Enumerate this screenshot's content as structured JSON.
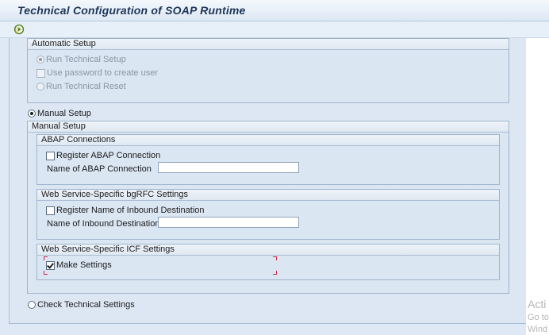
{
  "window": {
    "title": "Technical Configuration of SOAP Runtime"
  },
  "toolbar": {
    "execute_icon": "execute-icon"
  },
  "automatic_setup": {
    "header": "Automatic Setup",
    "run_technical_setup": "Run Technical Setup",
    "use_password": "Use password to create user",
    "run_technical_reset": "Run Technical Reset"
  },
  "manual_setup": {
    "radio_label": "Manual Setup",
    "header": "Manual Setup",
    "abap": {
      "header": "ABAP Connections",
      "register_label": "Register ABAP Connection",
      "name_label": "Name of ABAP Connection",
      "name_value": ""
    },
    "bgrfc": {
      "header": "Web Service-Specific bgRFC Settings",
      "register_label": "Register Name of Inbound Destination",
      "name_label": "Name of Inbound Destination",
      "name_value": ""
    },
    "icf": {
      "header": "Web Service-Specific ICF Settings",
      "make_settings_label": "Make Settings"
    }
  },
  "check_settings": {
    "radio_label": "Check Technical Settings"
  },
  "watermark": {
    "line1": "Acti",
    "line2": "Go to",
    "line3": "Wind"
  },
  "colors": {
    "accent": "#1d3557",
    "panel": "#dce7f3",
    "focus_marker": "#cc2a43"
  }
}
